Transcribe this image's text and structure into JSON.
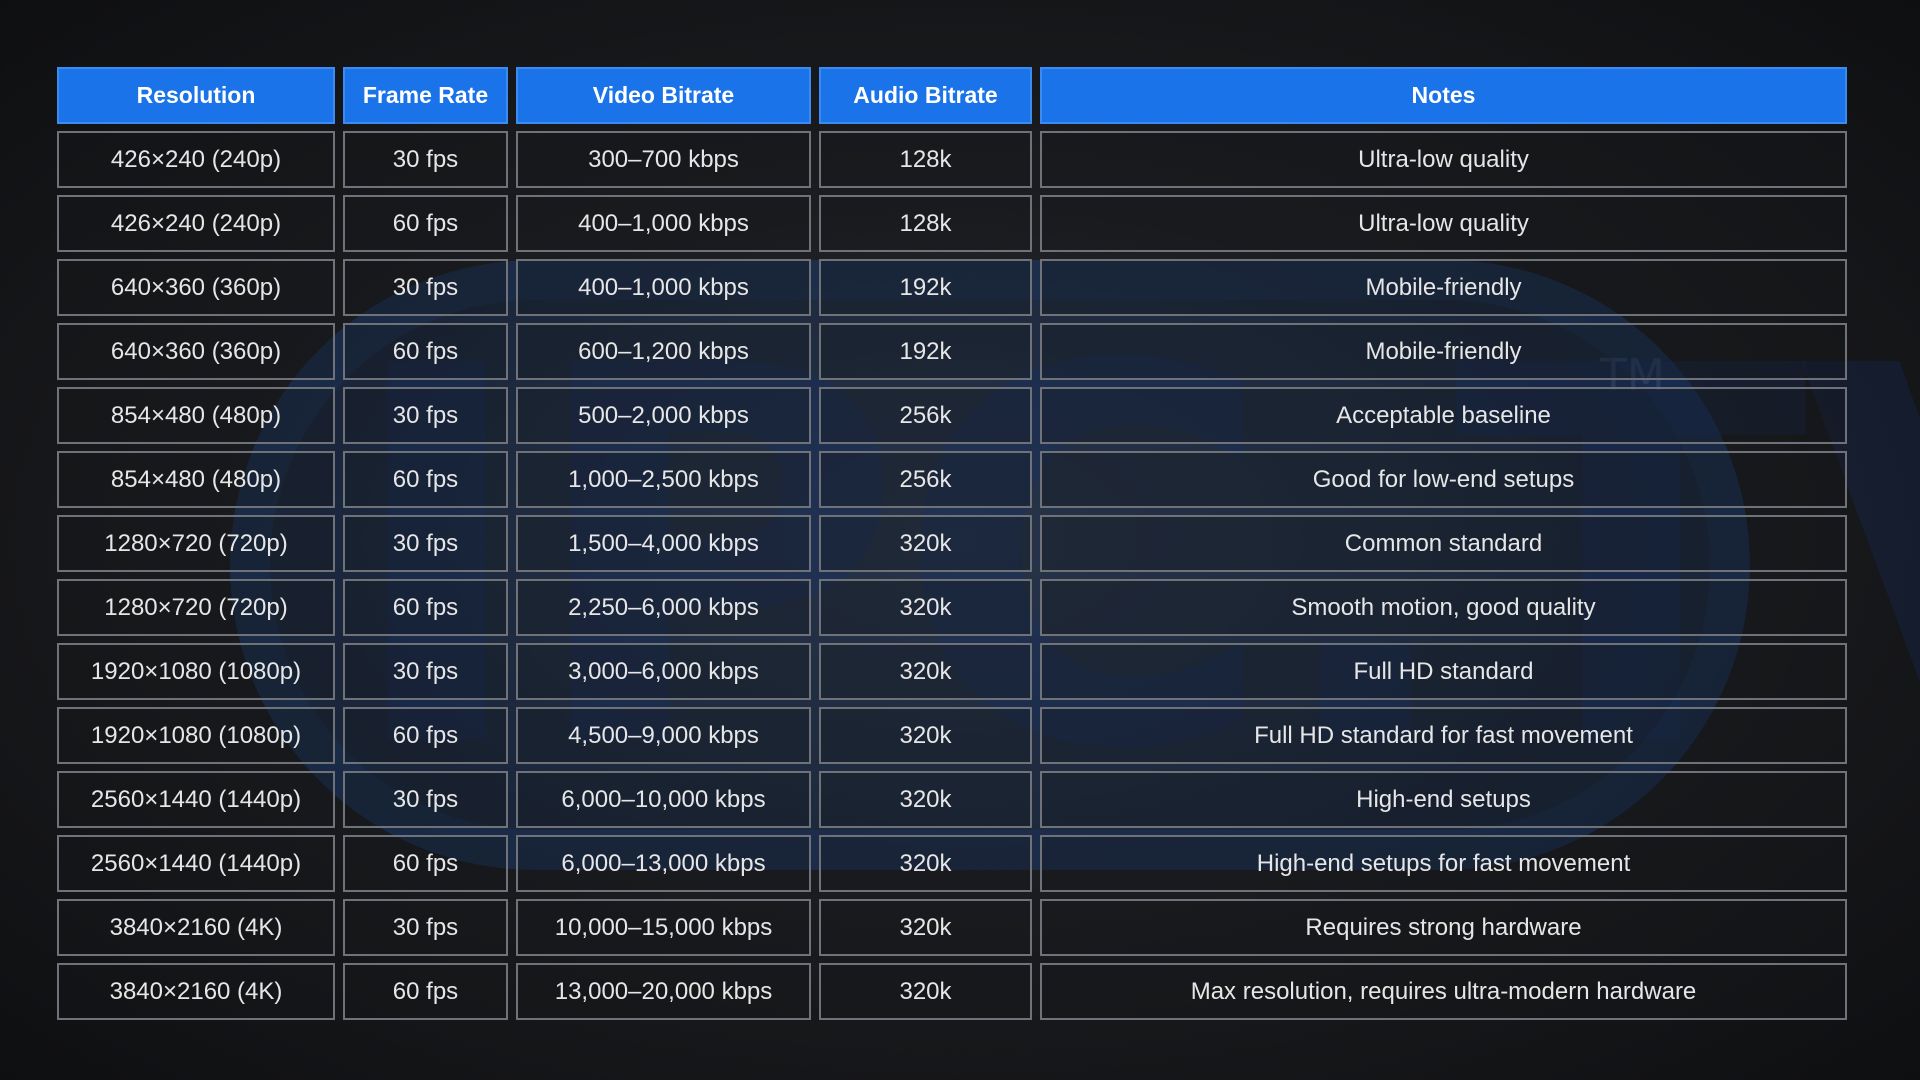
{
  "table": {
    "headers": [
      "Resolution",
      "Frame Rate",
      "Video Bitrate",
      "Audio Bitrate",
      "Notes"
    ],
    "rows": [
      [
        "426×240 (240p)",
        "30 fps",
        "300–700 kbps",
        "128k",
        "Ultra-low quality"
      ],
      [
        "426×240 (240p)",
        "60 fps",
        "400–1,000 kbps",
        "128k",
        "Ultra-low quality"
      ],
      [
        "640×360 (360p)",
        "30 fps",
        "400–1,000 kbps",
        "192k",
        "Mobile-friendly"
      ],
      [
        "640×360 (360p)",
        "60 fps",
        "600–1,200 kbps",
        "192k",
        "Mobile-friendly"
      ],
      [
        "854×480 (480p)",
        "30 fps",
        "500–2,000 kbps",
        "256k",
        "Acceptable baseline"
      ],
      [
        "854×480 (480p)",
        "60 fps",
        "1,000–2,500 kbps",
        "256k",
        "Good for low-end setups"
      ],
      [
        "1280×720 (720p)",
        "30 fps",
        "1,500–4,000 kbps",
        "320k",
        "Common standard"
      ],
      [
        "1280×720 (720p)",
        "60 fps",
        "2,250–6,000 kbps",
        "320k",
        "Smooth motion, good quality"
      ],
      [
        "1920×1080 (1080p)",
        "30 fps",
        "3,000–6,000 kbps",
        "320k",
        "Full HD standard"
      ],
      [
        "1920×1080 (1080p)",
        "60 fps",
        "4,500–9,000 kbps",
        "320k",
        "Full HD standard for fast movement"
      ],
      [
        "2560×1440 (1440p)",
        "30 fps",
        "6,000–10,000 kbps",
        "320k",
        "High-end setups"
      ],
      [
        "2560×1440 (1440p)",
        "60 fps",
        "6,000–13,000 kbps",
        "320k",
        "High-end setups for fast movement"
      ],
      [
        "3840×2160 (4K)",
        "30 fps",
        "10,000–15,000 kbps",
        "320k",
        "Requires strong hardware"
      ],
      [
        "3840×2160 (4K)",
        "60 fps",
        "13,000–20,000 kbps",
        "320k",
        "Max resolution, requires ultra-modern hardware"
      ]
    ]
  },
  "watermark": {
    "text": "IPC.TV",
    "tm": "TM"
  },
  "colors": {
    "header_bg": "#1a73e8",
    "cell_border": "#6f7278",
    "text": "#e6e6e6"
  }
}
